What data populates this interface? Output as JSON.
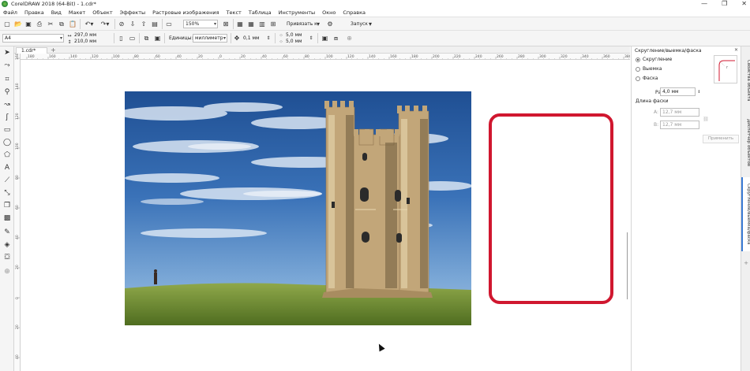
{
  "title": {
    "text": "CorelDRAW 2018 (64-Bit) - 1.cdr*",
    "minimize": "—",
    "restore": "❐",
    "close": "✕"
  },
  "menu": [
    "Файл",
    "Правка",
    "Вид",
    "Макет",
    "Объект",
    "Эффекты",
    "Растровые изображения",
    "Текст",
    "Таблица",
    "Инструменты",
    "Окно",
    "Справка"
  ],
  "toolbar": {
    "zoom": "150%",
    "snap": "Привязать к",
    "launch": "Запуск"
  },
  "propbar": {
    "page_size": "A4",
    "width": "297,0 мм",
    "height": "210,0 мм",
    "units_label": "Единицы:",
    "units": "миллиметр",
    "nudge": "0,1 мм",
    "dup_x": "5,0 мм",
    "dup_y": "5,0 мм"
  },
  "doc_tab": {
    "name": "1.cdr*",
    "add": "+"
  },
  "ruler_h": [
    "180",
    "160",
    "140",
    "120",
    "100",
    "80",
    "60",
    "40",
    "20",
    "0",
    "20",
    "40",
    "60",
    "80",
    "100",
    "120",
    "140",
    "160",
    "180",
    "200",
    "220",
    "240",
    "260",
    "280",
    "300",
    "320",
    "340",
    "360",
    "380"
  ],
  "ruler_v": [
    "160",
    "140",
    "120",
    "100",
    "80",
    "60",
    "40",
    "20",
    "0",
    "20",
    "40"
  ],
  "panel": {
    "header": "Скругление/выемка/фаска",
    "options": [
      "Скругление",
      "Выемка",
      "Фаска"
    ],
    "selected": 0,
    "radius_label": "Радиус:",
    "radius": "4,0 мм",
    "chamfer_label": "Длина фаски",
    "a_label": "A:",
    "a_value": "12,7 мм",
    "b_label": "B:",
    "b_value": "12,7 мм",
    "apply": "Применить"
  },
  "dock_tabs": [
    "Свойства объекта",
    "Диспетчер объектов",
    "Скругление/выемка/фаска"
  ],
  "colors": {
    "accent_rect": "#d0172f",
    "sky": "#2f5c9e",
    "grass": "#6e8a2c",
    "stone": "#c2a679"
  }
}
